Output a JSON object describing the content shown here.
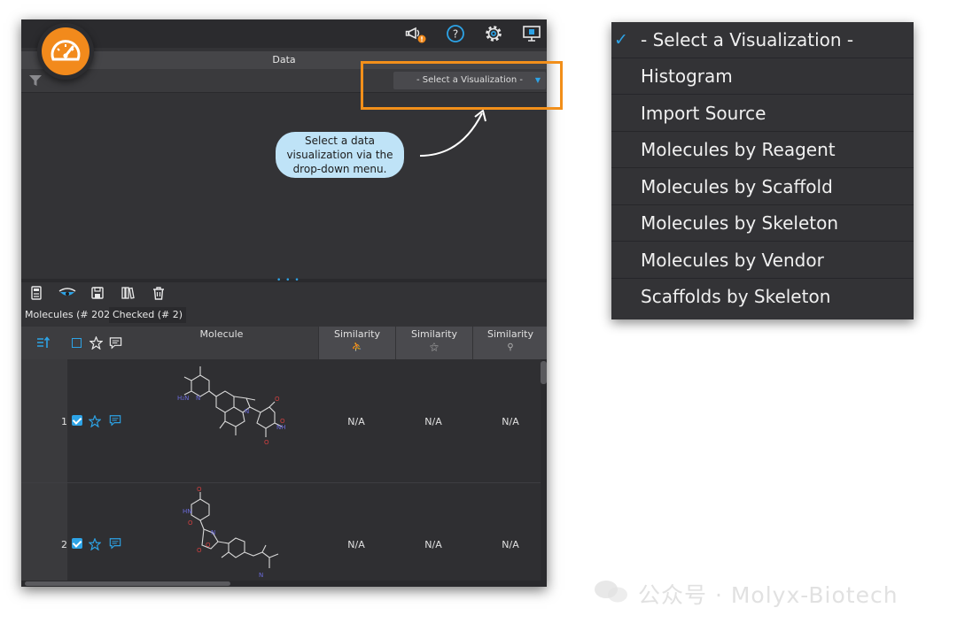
{
  "app": {
    "data_header": "Data",
    "viz_select": {
      "value": "- Select a Visualization -"
    },
    "tooltip_lines": [
      "Select a data",
      "visualization via the",
      "drop-down menu."
    ],
    "tabs": [
      {
        "label": "Molecules (# 202)"
      },
      {
        "label": "Checked (# 2)"
      }
    ],
    "grid": {
      "molecule_header": "Molecule",
      "similarity_headers": [
        "Similarity",
        "Similarity",
        "Similarity"
      ]
    },
    "rows": [
      {
        "num": "1",
        "sim": [
          "N/A",
          "N/A",
          "N/A"
        ]
      },
      {
        "num": "2",
        "sim": [
          "N/A",
          "N/A",
          "N/A"
        ]
      }
    ],
    "toolbar_icons": [
      "calculator-icon",
      "eye-icon",
      "save-icon",
      "library-icon",
      "trash-icon"
    ],
    "top_icons": [
      "announcement-icon",
      "help-icon",
      "settings-icon",
      "monitor-icon"
    ]
  },
  "dropdown_menu": {
    "items": [
      {
        "label": "- Select a Visualization -",
        "selected": true
      },
      {
        "label": "Histogram"
      },
      {
        "label": "Import Source"
      },
      {
        "label": "Molecules by Reagent"
      },
      {
        "label": "Molecules by Scaffold"
      },
      {
        "label": "Molecules by Skeleton"
      },
      {
        "label": "Molecules by Vendor"
      },
      {
        "label": "Scaffolds by Skeleton"
      }
    ]
  },
  "watermark": {
    "text": "公众号 · Molyx-Biotech"
  },
  "colors": {
    "accent": "#2da3e6",
    "brand_orange": "#f28a1c",
    "highlight": "#f28f1a",
    "tooltip_bg": "#bfe3f7",
    "panel_bg": "#333336"
  }
}
